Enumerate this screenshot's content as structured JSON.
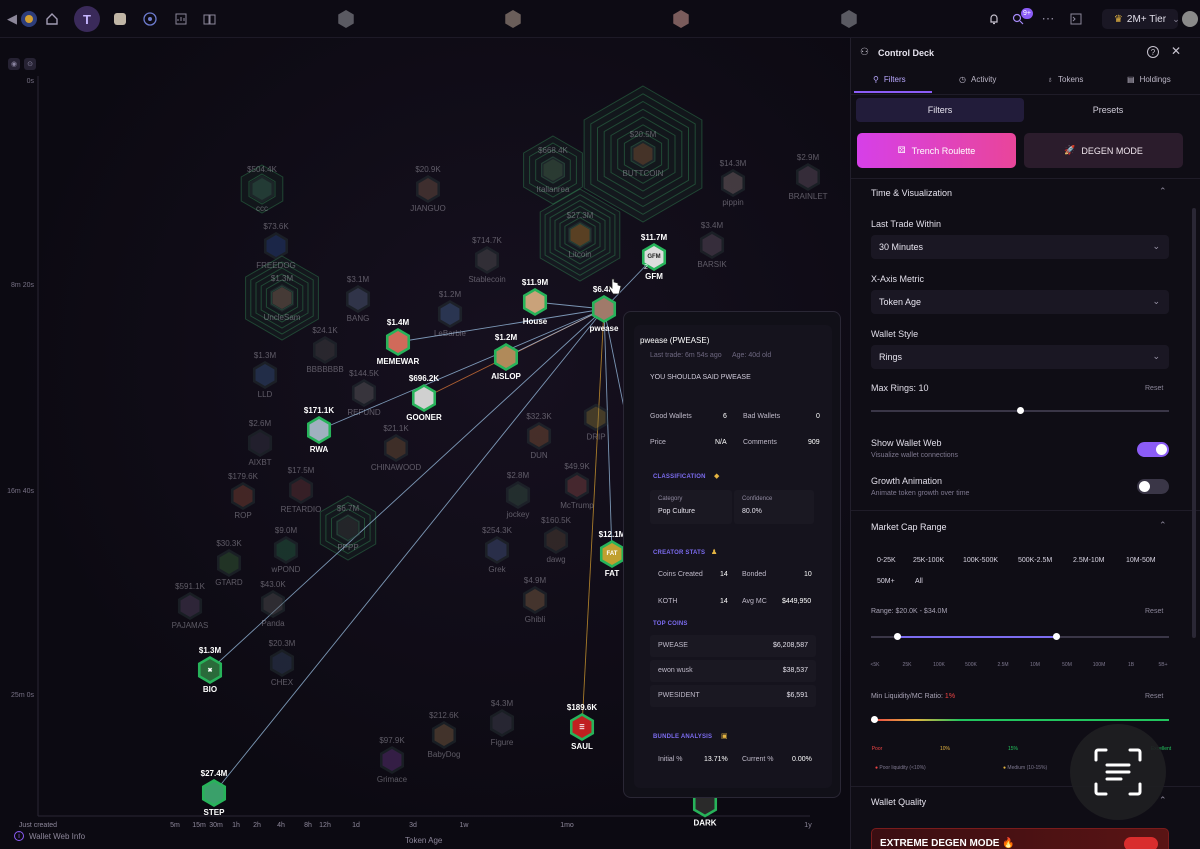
{
  "topbar": {
    "tier_label": "2M+ Tier",
    "notif_count": "9+"
  },
  "chart": {
    "y_labels": [
      {
        "label": "0s"
      },
      {
        "label": "8m 20s"
      },
      {
        "label": "16m 40s"
      },
      {
        "label": "25m 0s"
      }
    ],
    "x_labels": [
      "Just created",
      "5m",
      "15m",
      "30m",
      "1h",
      "2h",
      "4h",
      "8h",
      "12h",
      "1d",
      "3d",
      "1w",
      "1mo",
      "1y"
    ],
    "x_title": "Token Age",
    "wallet_web_info": "Wallet Web Info"
  },
  "tokens": [
    {
      "mc": "$504.4K",
      "name": "ccc",
      "dim": true,
      "color": "#3b6e5a"
    },
    {
      "mc": "$20.9K",
      "name": "JIANGUO",
      "dim": true,
      "color": "#7b5a4a"
    },
    {
      "mc": "$668.4K",
      "name": "Italianrea",
      "dim": true,
      "color": "#496b4f"
    },
    {
      "mc": "$20.5M",
      "name": "BUTTCOIN",
      "dim": true,
      "color": "#8a5a3a"
    },
    {
      "mc": "$14.3M",
      "name": "pippin",
      "dim": true,
      "color": "#8a7a7a"
    },
    {
      "mc": "$2.9M",
      "name": "BRAINLET",
      "dim": true,
      "color": "#6b5a6b"
    },
    {
      "mc": "$73.6K",
      "name": "FREEDOG",
      "dim": true,
      "color": "#2b4a8a"
    },
    {
      "mc": "$714.7K",
      "name": "Stablecoin",
      "dim": true,
      "color": "#5a5a5a"
    },
    {
      "mc": "$27.3M",
      "name": "Litcoin",
      "dim": true,
      "color": "#b8792a"
    },
    {
      "mc": "$3.4M",
      "name": "BARSIK",
      "dim": true,
      "color": "#6b5a6b"
    },
    {
      "mc": "$11.7M",
      "name": "GFM",
      "dim": false,
      "color": "#dcdcdc",
      "label": "GFM"
    },
    {
      "mc": "$1.3M",
      "name": "UncleSam",
      "dim": true,
      "color": "#8a6a5a"
    },
    {
      "mc": "$3.1M",
      "name": "BANG",
      "dim": true,
      "color": "#5a6a8a"
    },
    {
      "mc": "$1.2M",
      "name": "LeBarbie",
      "dim": true,
      "color": "#4a6a9a"
    },
    {
      "mc": "$11.9M",
      "name": "House",
      "dim": false,
      "color": "#c9a27a"
    },
    {
      "mc": "$6.4M",
      "name": "pwease",
      "dim": false,
      "color": "#a07a6a"
    },
    {
      "mc": "$24.1K",
      "name": "BBBBBBB",
      "dim": true,
      "color": "#4a4a4a"
    },
    {
      "mc": "$1.4M",
      "name": "MEMEWAR",
      "dim": false,
      "color": "#d06a5a"
    },
    {
      "mc": "$1.2M",
      "name": "AISLOP",
      "dim": false,
      "color": "#b08a5a"
    },
    {
      "mc": "$1.3M",
      "name": "LLD",
      "dim": true,
      "color": "#3a5a8a"
    },
    {
      "mc": "$144.5K",
      "name": "REFUND",
      "dim": true,
      "color": "#6a6a6a"
    },
    {
      "mc": "$696.2K",
      "name": "GOONER",
      "dim": false,
      "color": "#d0d0d0"
    },
    {
      "mc": "$171.1K",
      "name": "RWA",
      "dim": false,
      "color": "#a0b0c0"
    },
    {
      "mc": "$2.6M",
      "name": "AIXBT",
      "dim": true,
      "color": "#3a3a4a"
    },
    {
      "mc": "$21.1K",
      "name": "CHINAWOOD",
      "dim": true,
      "color": "#7a5a3a"
    },
    {
      "mc": "$32.3K",
      "name": "DUN",
      "dim": true,
      "color": "#8a5a3a"
    },
    {
      "mc": "",
      "name": "DRIP",
      "dim": true,
      "color": "#8a7a3a"
    },
    {
      "mc": "$179.6K",
      "name": "ROP",
      "dim": true,
      "color": "#8a4a3a"
    },
    {
      "mc": "$17.5M",
      "name": "RETARDIO",
      "dim": true,
      "color": "#6a3a3a"
    },
    {
      "mc": "$2.8M",
      "name": "jockey",
      "dim": true,
      "color": "#3a5a4a"
    },
    {
      "mc": "$49.9K",
      "name": "McTrump",
      "dim": true,
      "color": "#8a4a4a"
    },
    {
      "mc": "$6.7M",
      "name": "PPPP",
      "dim": true,
      "color": "#3a3a3a"
    },
    {
      "mc": "$9.0M",
      "name": "wPOND",
      "dim": true,
      "color": "#2a6a4a"
    },
    {
      "mc": "$254.3K",
      "name": "Grek",
      "dim": true,
      "color": "#4a5a8a"
    },
    {
      "mc": "$160.5K",
      "name": "dawg",
      "dim": true,
      "color": "#5a4a3a"
    },
    {
      "mc": "$12.1M",
      "name": "FAT",
      "dim": false,
      "color": "#c0a030",
      "label": "FAT"
    },
    {
      "mc": "$30.3K",
      "name": "GTARD",
      "dim": true,
      "color": "#3a6a3a"
    },
    {
      "mc": "$43.0K",
      "name": "Panda",
      "dim": true,
      "color": "#5a5a5a"
    },
    {
      "mc": "$4.9M",
      "name": "Ghibli",
      "dim": true,
      "color": "#8a6a4a"
    },
    {
      "mc": "$591.1K",
      "name": "PAJAMAS",
      "dim": true,
      "color": "#5a4a6a"
    },
    {
      "mc": "$1.3M",
      "name": "BIO",
      "dim": false,
      "color": "#2a6a3a",
      "label": "✖"
    },
    {
      "mc": "$20.3M",
      "name": "CHEX",
      "dim": true,
      "color": "#3a4a6a"
    },
    {
      "mc": "$4.3M",
      "name": "Figure",
      "dim": true,
      "color": "#4a4a5a"
    },
    {
      "mc": "$212.6K",
      "name": "BabyDog",
      "dim": true,
      "color": "#8a6a4a"
    },
    {
      "mc": "$189.6K",
      "name": "SAUL",
      "dim": false,
      "color": "#c02020",
      "label": "☰"
    },
    {
      "mc": "$97.9K",
      "name": "Grimace",
      "dim": true,
      "color": "#6a3a8a"
    },
    {
      "mc": "$27.4M",
      "name": "STEP",
      "dim": false,
      "color": "#3aa06a"
    },
    {
      "mc": "",
      "name": "DARK",
      "dim": false,
      "color": "#2a2a2a"
    }
  ],
  "tooltip": {
    "name": "pwease (PWEASE)",
    "last_trade": "Last trade: 6m 54s ago",
    "age": "Age: 40d old",
    "description": "YOU SHOULDA SAID PWEASE",
    "good_wallets_label": "Good Wallets",
    "good_wallets": "6",
    "bad_wallets_label": "Bad Wallets",
    "bad_wallets": "0",
    "price_label": "Price",
    "price": "N/A",
    "comments_label": "Comments",
    "comments": "909",
    "classification_title": "CLASSIFICATION",
    "category_label": "Category",
    "category": "Pop Culture",
    "confidence_label": "Confidence",
    "confidence": "80.0%",
    "creator_title": "CREATOR STATS",
    "coins_created_label": "Coins Created",
    "coins_created": "14",
    "bonded_label": "Bonded",
    "bonded": "10",
    "koth_label": "KOTH",
    "koth": "14",
    "avg_mc_label": "Avg MC",
    "avg_mc": "$449,950",
    "top_coins_title": "TOP COINS",
    "top_coins": [
      {
        "name": "PWEASE",
        "value": "$6,208,587"
      },
      {
        "name": "ewon wusk",
        "value": "$38,537"
      },
      {
        "name": "PWESIDENT",
        "value": "$6,591"
      }
    ],
    "bundle_title": "BUNDLE ANALYSIS",
    "initial_label": "Initial %",
    "initial": "13.71%",
    "current_label": "Current %",
    "current": "0.00%"
  },
  "panel": {
    "title": "Control Deck",
    "tabs": [
      "Filters",
      "Activity",
      "Tokens",
      "Holdings"
    ],
    "subtabs": [
      "Filters",
      "Presets"
    ],
    "roulette_label": "Trench Roulette",
    "degen_label": "DEGEN MODE",
    "time_vis_title": "Time & Visualization",
    "last_trade_label": "Last Trade Within",
    "last_trade_value": "30 Minutes",
    "x_axis_label": "X-Axis Metric",
    "x_axis_value": "Token Age",
    "wallet_style_label": "Wallet Style",
    "wallet_style_value": "Rings",
    "max_rings_label": "Max Rings: 10",
    "max_rings_value": 0.5,
    "reset_label": "Reset",
    "show_web_label": "Show Wallet Web",
    "show_web_sub": "Visualize wallet connections",
    "show_web_on": true,
    "growth_label": "Growth Animation",
    "growth_sub": "Animate token growth over time",
    "growth_on": false,
    "mc_range_title": "Market Cap Range",
    "mc_chips": [
      "0-25K",
      "25K-100K",
      "100K-500K",
      "500K-2.5M",
      "2.5M-10M",
      "10M-50M",
      "50M+",
      "All"
    ],
    "range_label": "Range: $20.0K - $34.0M",
    "range_ticks": [
      "<5K",
      "25K",
      "100K",
      "500K",
      "2.5M",
      "10M",
      "50M",
      "100M",
      "1B",
      "5B+"
    ],
    "liq_label": "Min Liquidity/MC Ratio:",
    "liq_value": "1%",
    "liq_ticks": [
      "Poor",
      "10%",
      "15%",
      "Excellent"
    ],
    "liq_legend": [
      "Poor liquidity (<10%)",
      "Medium (10-15%)"
    ],
    "wallet_quality_title": "Wallet Quality",
    "extreme_label": "EXTREME DEGEN MODE"
  },
  "colors": {
    "accent": "#8b5cf6",
    "green": "#27b35a",
    "roulette_start": "#d640e8",
    "roulette_end": "#e9459a"
  }
}
